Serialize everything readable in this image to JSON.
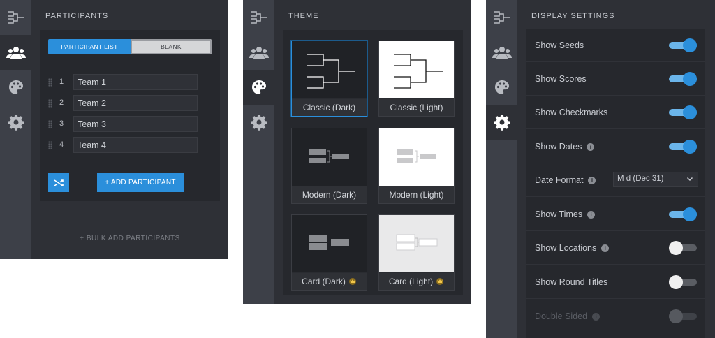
{
  "participants_panel": {
    "title": "PARTICIPANTS",
    "tabs": [
      "PARTICIPANT LIST",
      "BLANK"
    ],
    "participants": [
      {
        "num": "1",
        "name": "Team 1"
      },
      {
        "num": "2",
        "name": "Team 2"
      },
      {
        "num": "3",
        "name": "Team 3"
      },
      {
        "num": "4",
        "name": "Team 4"
      }
    ],
    "add_button": "+ ADD PARTICIPANT",
    "bulk_add": "+ BULK ADD PARTICIPANTS"
  },
  "theme_panel": {
    "title": "THEME",
    "themes": [
      {
        "label": "Classic (Dark)",
        "selected": true
      },
      {
        "label": "Classic (Light)"
      },
      {
        "label": "Modern (Dark)"
      },
      {
        "label": "Modern (Light)"
      },
      {
        "label": "Card (Dark)",
        "premium_icon": "crown-icon"
      },
      {
        "label": "Card (Light)",
        "premium_icon": "crown-icon"
      }
    ]
  },
  "settings_panel": {
    "title": "DISPLAY SETTINGS",
    "rows": [
      {
        "label": "Show Seeds",
        "on": true
      },
      {
        "label": "Show Scores",
        "on": true
      },
      {
        "label": "Show Checkmarks",
        "on": true
      },
      {
        "label": "Show Dates",
        "on": true
      },
      {
        "label": "Date Format",
        "value": "M d (Dec 31)"
      },
      {
        "label": "Show Times",
        "on": true
      },
      {
        "label": "Show Locations",
        "on": false
      },
      {
        "label": "Show Round Titles",
        "on": false
      },
      {
        "label": "Double Sided",
        "on": false,
        "disabled": true
      }
    ]
  },
  "colors": {
    "accent": "#2b8fdb",
    "accent_light": "#6bb5ea",
    "panel": "#2e3036",
    "rail": "#3d4048",
    "content": "#26282d"
  },
  "icons": {
    "bracket": "bracket-icon",
    "participants": "users-icon",
    "theme": "palette-icon",
    "settings": "gear-icon",
    "shuffle": "shuffle-icon",
    "crown": "crown-icon",
    "info": "info-icon"
  }
}
